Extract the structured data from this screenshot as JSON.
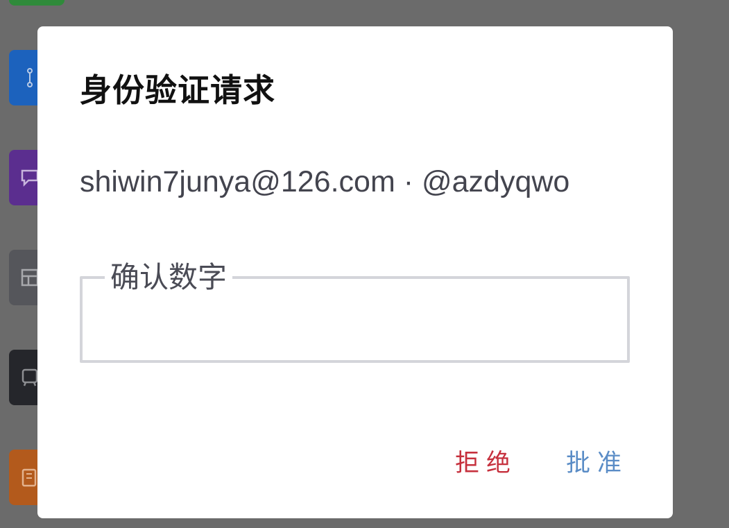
{
  "background_apps": [
    {
      "name": "green-app",
      "color": "#2f8a3a",
      "icon": "app-icon"
    },
    {
      "name": "git-app",
      "color": "#1c62bd",
      "icon": "branch-icon"
    },
    {
      "name": "chat-app",
      "color": "#5b2e8f",
      "icon": "chat-bubble-icon"
    },
    {
      "name": "table-app",
      "color": "#55565b",
      "icon": "table-icon"
    },
    {
      "name": "tram-app",
      "color": "#25262b",
      "icon": "tram-icon"
    },
    {
      "name": "building-app",
      "color": "#b35a1c",
      "icon": "building-icon"
    }
  ],
  "dialog": {
    "title": "身份验证请求",
    "subtitle": "shiwin7junya@126.com · @azdyqwo",
    "field": {
      "label": "确认数字",
      "value": ""
    },
    "buttons": {
      "reject": "拒绝",
      "approve": "批准"
    }
  },
  "colors": {
    "scrim": "#6b6b6b",
    "reject": "#c6303d",
    "approve": "#5a8cc6",
    "field_border": "#d4d5da"
  }
}
